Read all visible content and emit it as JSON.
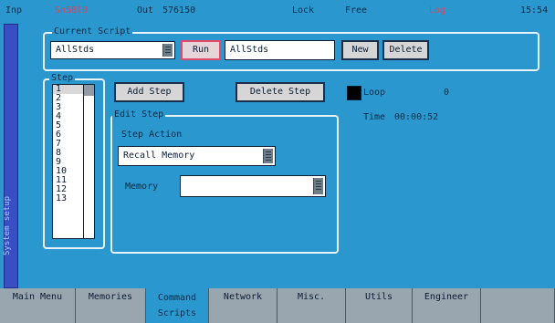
{
  "status": {
    "input_label": "Inp",
    "input_value": "Sn5Bl0",
    "output_label": "Out",
    "output_value": "576150",
    "lock_label": "Lock",
    "free_label": "Free",
    "log_label": "Log",
    "time": "15:54"
  },
  "sidebar": {
    "label": "System setup"
  },
  "current_script": {
    "title": "Current Script",
    "selected": "AllStds",
    "run_label": "Run",
    "name_value": "AllStds",
    "new_label": "New",
    "delete_label": "Delete"
  },
  "step": {
    "title": "Step",
    "items": [
      "1",
      "2",
      "3",
      "4",
      "5",
      "6",
      "7",
      "8",
      "9",
      "10",
      "11",
      "12",
      "13"
    ],
    "selected_index": 0,
    "add_label": "Add Step",
    "delete_label": "Delete Step",
    "loop_label": "Loop",
    "loop_count": "0",
    "time_label": "Time",
    "time_value": "00:00:52"
  },
  "edit_step": {
    "title": "Edit Step",
    "action_label": "Step Action",
    "action_value": "Recall Memory",
    "memory_label": "Memory",
    "memory_value": ""
  },
  "tabs": [
    {
      "label": "Main Menu"
    },
    {
      "label": "Memories"
    },
    {
      "label": "Command Scripts"
    },
    {
      "label": "Network"
    },
    {
      "label": "Misc."
    },
    {
      "label": "Utils"
    },
    {
      "label": "Engineer"
    }
  ],
  "colors": {
    "background": "#2a98cf",
    "side_tab": "#3a4ec4",
    "accent_red": "#e3415b",
    "tab_inactive": "#9aa6af"
  }
}
